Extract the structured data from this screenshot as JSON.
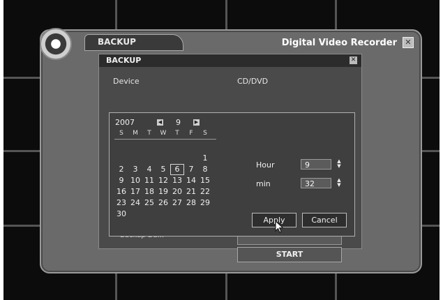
{
  "window": {
    "tab_title": "BACKUP",
    "app_title": "Digital Video Recorder",
    "close_glyph": "✕"
  },
  "backup": {
    "title": "BACKUP",
    "close_glyph": "✕",
    "device_label": "Device",
    "device_value": "CD/DVD",
    "hidden_label": "Backup Da...",
    "date_value": "",
    "start_label": "START"
  },
  "calendar": {
    "year": "2007",
    "month": "9",
    "prev_glyph": "◀",
    "next_glyph": "▶",
    "weekdays": [
      "S",
      "M",
      "T",
      "W",
      "T",
      "F",
      "S"
    ],
    "selected_day": "6",
    "days": [
      "1",
      "2",
      "3",
      "4",
      "5",
      "6",
      "7",
      "8",
      "9",
      "10",
      "11",
      "12",
      "13",
      "14",
      "15",
      "16",
      "17",
      "18",
      "19",
      "20",
      "21",
      "22",
      "23",
      "24",
      "25",
      "26",
      "27",
      "28",
      "29",
      "30"
    ]
  },
  "time": {
    "hour_label": "Hour",
    "hour_value": "9",
    "min_label": "min",
    "min_value": "32",
    "spin_glyph_up": "▲",
    "spin_glyph_down": "▼"
  },
  "buttons": {
    "apply": "Apply",
    "cancel": "Cancel"
  },
  "icons": [
    "dvr-logo-icon",
    "close-icon",
    "prev-arrow-icon",
    "next-arrow-icon",
    "spinner-icon",
    "mouse-cursor-icon"
  ]
}
